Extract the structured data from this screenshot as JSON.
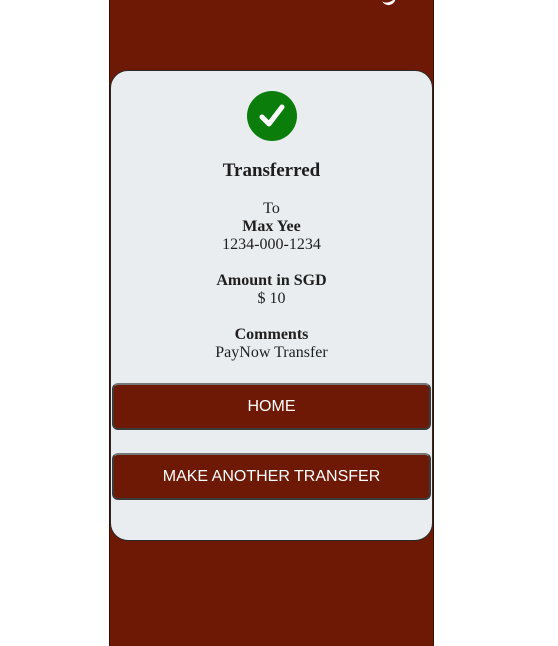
{
  "status": {
    "icon": "check-icon",
    "icon_color": "#0a7d0a",
    "title": "Transferred"
  },
  "recipient": {
    "to_label": "To",
    "name": "Max Yee",
    "account": "1234-000-1234"
  },
  "amount": {
    "label": "Amount in SGD",
    "value": "$ 10"
  },
  "comments": {
    "label": "Comments",
    "value": "PayNow Transfer"
  },
  "actions": {
    "home_label": "HOME",
    "another_label": "MAKE ANOTHER TRANSFER"
  },
  "colors": {
    "brand": "#6e1905",
    "card_bg": "#e9edf0"
  }
}
